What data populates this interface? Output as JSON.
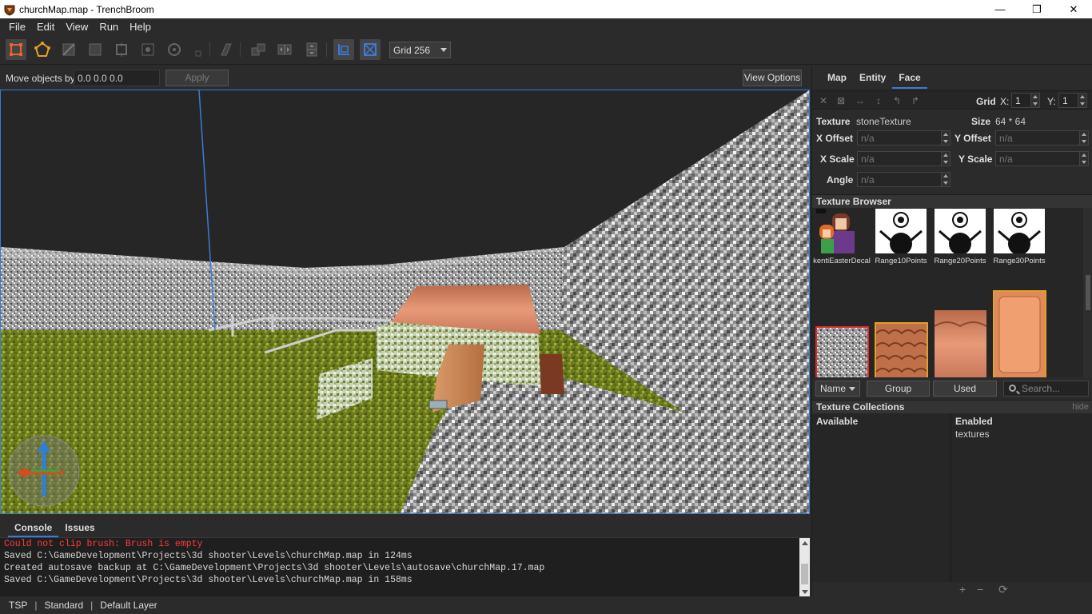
{
  "window": {
    "title": "churchMap.map - TrenchBroom",
    "minimize": "—",
    "maximize": "❐",
    "close": "✕"
  },
  "menu": [
    "File",
    "Edit",
    "View",
    "Run",
    "Help"
  ],
  "toolbar": {
    "grid_select": "Grid 256",
    "tools": [
      "select-tool",
      "vertex-tool",
      "edge-tool",
      "face-tool",
      "brush-tool",
      "entity-tool",
      "rotate-tool",
      "scale-tool",
      "clip-tool",
      "csg-tool",
      "flip-horizontal-tool",
      "flip-vertical-tool",
      "texture-lock",
      "uv-lock"
    ]
  },
  "movebar": {
    "label": "Move objects by",
    "value": "0.0 0.0 0.0",
    "apply": "Apply",
    "view_options": "View Options"
  },
  "console": {
    "tabs": [
      "Console",
      "Issues"
    ],
    "lines": [
      {
        "text": "Could not clip brush: Brush is empty",
        "error": true
      },
      {
        "text": "Saved C:\\GameDevelopment\\Projects\\3d shooter\\Levels\\churchMap.map in 124ms",
        "error": false
      },
      {
        "text": "Created autosave backup at C:\\GameDevelopment\\Projects\\3d shooter\\Levels\\autosave\\churchMap.17.map",
        "error": false
      },
      {
        "text": "Saved C:\\GameDevelopment\\Projects\\3d shooter\\Levels\\churchMap.map in 158ms",
        "error": false
      }
    ]
  },
  "statusbar": {
    "engine": "TSP",
    "mode": "Standard",
    "layer": "Default Layer"
  },
  "inspector": {
    "tabs": [
      "Map",
      "Entity",
      "Face"
    ],
    "grid_label": "Grid",
    "grid_x_label": "X:",
    "grid_x": "1",
    "grid_y_label": "Y:",
    "grid_y": "1",
    "texture_label": "Texture",
    "texture_value": "stoneTexture",
    "size_label": "Size",
    "size_value": "64 * 64",
    "x_offset_label": "X Offset",
    "y_offset_label": "Y Offset",
    "x_scale_label": "X Scale",
    "y_scale_label": "Y Scale",
    "angle_label": "Angle",
    "na": "n/a"
  },
  "texture_browser": {
    "title": "Texture Browser",
    "textures": [
      "kentiEasterDecal",
      "Range10Points",
      "Range20Points",
      "Range30Points"
    ],
    "sort_select": "Name",
    "group_button": "Group",
    "used_button": "Used",
    "search_placeholder": "Search..."
  },
  "texture_collections": {
    "title": "Texture Collections",
    "hide": "hide",
    "available": "Available",
    "enabled": "Enabled",
    "enabled_items": [
      "textures"
    ],
    "add": "+",
    "remove": "−",
    "reload": "⟳"
  }
}
